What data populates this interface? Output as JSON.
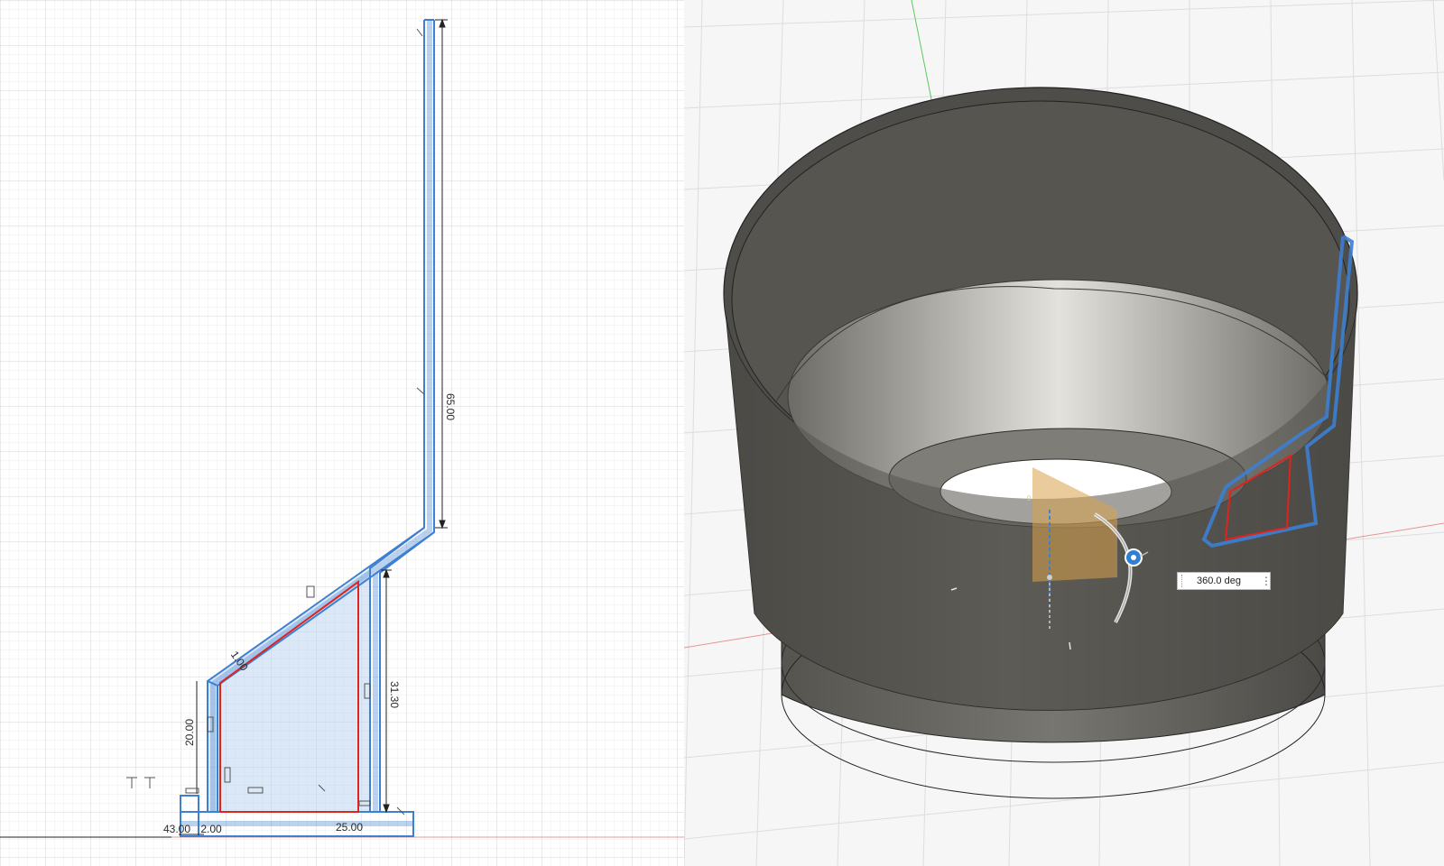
{
  "sketch": {
    "dimensions": {
      "top_vertical": "65.00",
      "right_vertical": "31.30",
      "left_vertical": "20.00",
      "bottom_horizontal": "25.00",
      "bottom_left": "43.00",
      "bottom_small": "2.00",
      "slant": "1.00"
    },
    "colors": {
      "profile": "#3d7fd1",
      "profile_fill": "#bcd6f1",
      "selection": "#e0231c",
      "grid_minor": "#ececec",
      "grid_major": "#d4d4d4"
    }
  },
  "model": {
    "revolve_angle": "360.0 deg",
    "colors": {
      "body": "#5f5e5a",
      "body_dark": "#3f3e3b",
      "inner_light": "#d9d7d2",
      "axis_x": "#e06a6a",
      "axis_y": "#5cc85c",
      "manipulator": "#2f7fd3"
    },
    "icons": [
      "grip-icon",
      "more-options-icon",
      "rotate-handle-icon"
    ]
  }
}
